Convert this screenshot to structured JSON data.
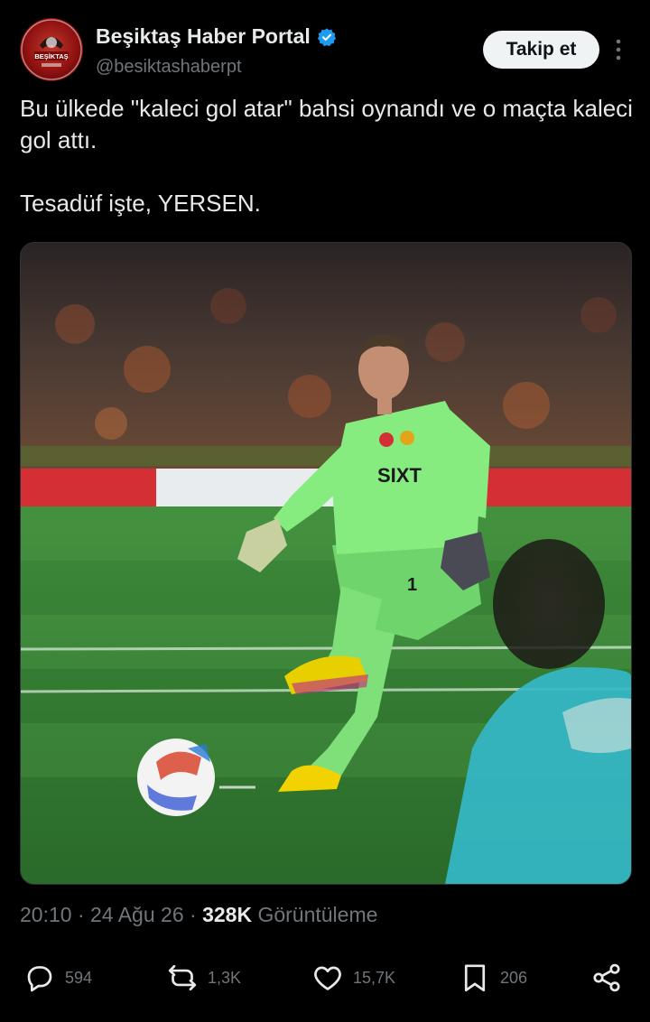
{
  "author": {
    "name": "Beşiktaş Haber Portal",
    "handle": "@besiktashaberpt",
    "avatar_text": "BEŞİKTAŞ",
    "verified": true
  },
  "follow_label": "Takip et",
  "tweet": {
    "line1": "Bu ülkede \"kaleci gol atar\" bahsi oynandı ve o maçta kaleci gol attı.",
    "line2": "Tesadüf işte, YERSEN."
  },
  "media": {
    "shirt_sponsor": "SIXT",
    "shirt_number": "1"
  },
  "meta": {
    "time": "20:10",
    "date": "24 Ağu 26",
    "views_count": "328K",
    "views_label": "Görüntüleme",
    "separator": "·"
  },
  "actions": {
    "replies": "594",
    "reposts": "1,3K",
    "likes": "15,7K",
    "bookmarks": "206"
  },
  "colors": {
    "background": "#000000",
    "text": "#e7e9ea",
    "muted": "#71767b",
    "verified_blue": "#1d9bf0",
    "follow_bg": "#eff3f4"
  },
  "icons": [
    "more-icon",
    "verified-icon",
    "reply-icon",
    "repost-icon",
    "like-icon",
    "bookmark-icon",
    "share-icon"
  ]
}
